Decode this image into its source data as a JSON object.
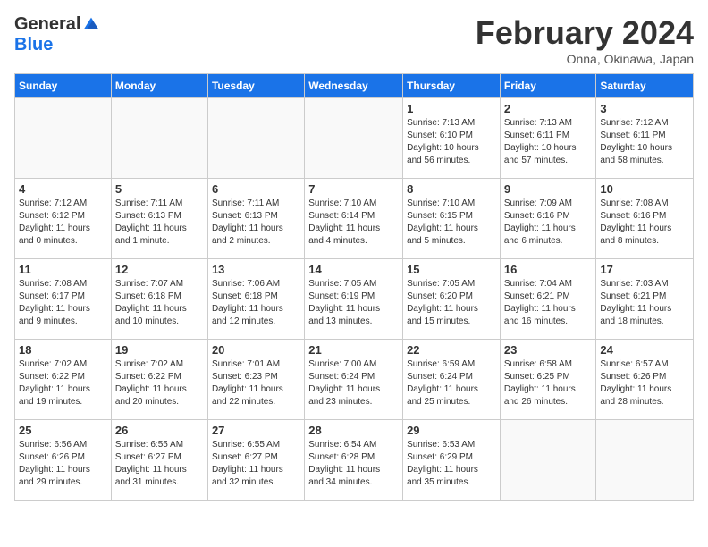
{
  "header": {
    "logo_general": "General",
    "logo_blue": "Blue",
    "month_title": "February 2024",
    "location": "Onna, Okinawa, Japan"
  },
  "columns": [
    "Sunday",
    "Monday",
    "Tuesday",
    "Wednesday",
    "Thursday",
    "Friday",
    "Saturday"
  ],
  "weeks": [
    [
      {
        "day": "",
        "info": ""
      },
      {
        "day": "",
        "info": ""
      },
      {
        "day": "",
        "info": ""
      },
      {
        "day": "",
        "info": ""
      },
      {
        "day": "1",
        "info": "Sunrise: 7:13 AM\nSunset: 6:10 PM\nDaylight: 10 hours\nand 56 minutes."
      },
      {
        "day": "2",
        "info": "Sunrise: 7:13 AM\nSunset: 6:11 PM\nDaylight: 10 hours\nand 57 minutes."
      },
      {
        "day": "3",
        "info": "Sunrise: 7:12 AM\nSunset: 6:11 PM\nDaylight: 10 hours\nand 58 minutes."
      }
    ],
    [
      {
        "day": "4",
        "info": "Sunrise: 7:12 AM\nSunset: 6:12 PM\nDaylight: 11 hours\nand 0 minutes."
      },
      {
        "day": "5",
        "info": "Sunrise: 7:11 AM\nSunset: 6:13 PM\nDaylight: 11 hours\nand 1 minute."
      },
      {
        "day": "6",
        "info": "Sunrise: 7:11 AM\nSunset: 6:13 PM\nDaylight: 11 hours\nand 2 minutes."
      },
      {
        "day": "7",
        "info": "Sunrise: 7:10 AM\nSunset: 6:14 PM\nDaylight: 11 hours\nand 4 minutes."
      },
      {
        "day": "8",
        "info": "Sunrise: 7:10 AM\nSunset: 6:15 PM\nDaylight: 11 hours\nand 5 minutes."
      },
      {
        "day": "9",
        "info": "Sunrise: 7:09 AM\nSunset: 6:16 PM\nDaylight: 11 hours\nand 6 minutes."
      },
      {
        "day": "10",
        "info": "Sunrise: 7:08 AM\nSunset: 6:16 PM\nDaylight: 11 hours\nand 8 minutes."
      }
    ],
    [
      {
        "day": "11",
        "info": "Sunrise: 7:08 AM\nSunset: 6:17 PM\nDaylight: 11 hours\nand 9 minutes."
      },
      {
        "day": "12",
        "info": "Sunrise: 7:07 AM\nSunset: 6:18 PM\nDaylight: 11 hours\nand 10 minutes."
      },
      {
        "day": "13",
        "info": "Sunrise: 7:06 AM\nSunset: 6:18 PM\nDaylight: 11 hours\nand 12 minutes."
      },
      {
        "day": "14",
        "info": "Sunrise: 7:05 AM\nSunset: 6:19 PM\nDaylight: 11 hours\nand 13 minutes."
      },
      {
        "day": "15",
        "info": "Sunrise: 7:05 AM\nSunset: 6:20 PM\nDaylight: 11 hours\nand 15 minutes."
      },
      {
        "day": "16",
        "info": "Sunrise: 7:04 AM\nSunset: 6:21 PM\nDaylight: 11 hours\nand 16 minutes."
      },
      {
        "day": "17",
        "info": "Sunrise: 7:03 AM\nSunset: 6:21 PM\nDaylight: 11 hours\nand 18 minutes."
      }
    ],
    [
      {
        "day": "18",
        "info": "Sunrise: 7:02 AM\nSunset: 6:22 PM\nDaylight: 11 hours\nand 19 minutes."
      },
      {
        "day": "19",
        "info": "Sunrise: 7:02 AM\nSunset: 6:22 PM\nDaylight: 11 hours\nand 20 minutes."
      },
      {
        "day": "20",
        "info": "Sunrise: 7:01 AM\nSunset: 6:23 PM\nDaylight: 11 hours\nand 22 minutes."
      },
      {
        "day": "21",
        "info": "Sunrise: 7:00 AM\nSunset: 6:24 PM\nDaylight: 11 hours\nand 23 minutes."
      },
      {
        "day": "22",
        "info": "Sunrise: 6:59 AM\nSunset: 6:24 PM\nDaylight: 11 hours\nand 25 minutes."
      },
      {
        "day": "23",
        "info": "Sunrise: 6:58 AM\nSunset: 6:25 PM\nDaylight: 11 hours\nand 26 minutes."
      },
      {
        "day": "24",
        "info": "Sunrise: 6:57 AM\nSunset: 6:26 PM\nDaylight: 11 hours\nand 28 minutes."
      }
    ],
    [
      {
        "day": "25",
        "info": "Sunrise: 6:56 AM\nSunset: 6:26 PM\nDaylight: 11 hours\nand 29 minutes."
      },
      {
        "day": "26",
        "info": "Sunrise: 6:55 AM\nSunset: 6:27 PM\nDaylight: 11 hours\nand 31 minutes."
      },
      {
        "day": "27",
        "info": "Sunrise: 6:55 AM\nSunset: 6:27 PM\nDaylight: 11 hours\nand 32 minutes."
      },
      {
        "day": "28",
        "info": "Sunrise: 6:54 AM\nSunset: 6:28 PM\nDaylight: 11 hours\nand 34 minutes."
      },
      {
        "day": "29",
        "info": "Sunrise: 6:53 AM\nSunset: 6:29 PM\nDaylight: 11 hours\nand 35 minutes."
      },
      {
        "day": "",
        "info": ""
      },
      {
        "day": "",
        "info": ""
      }
    ]
  ]
}
